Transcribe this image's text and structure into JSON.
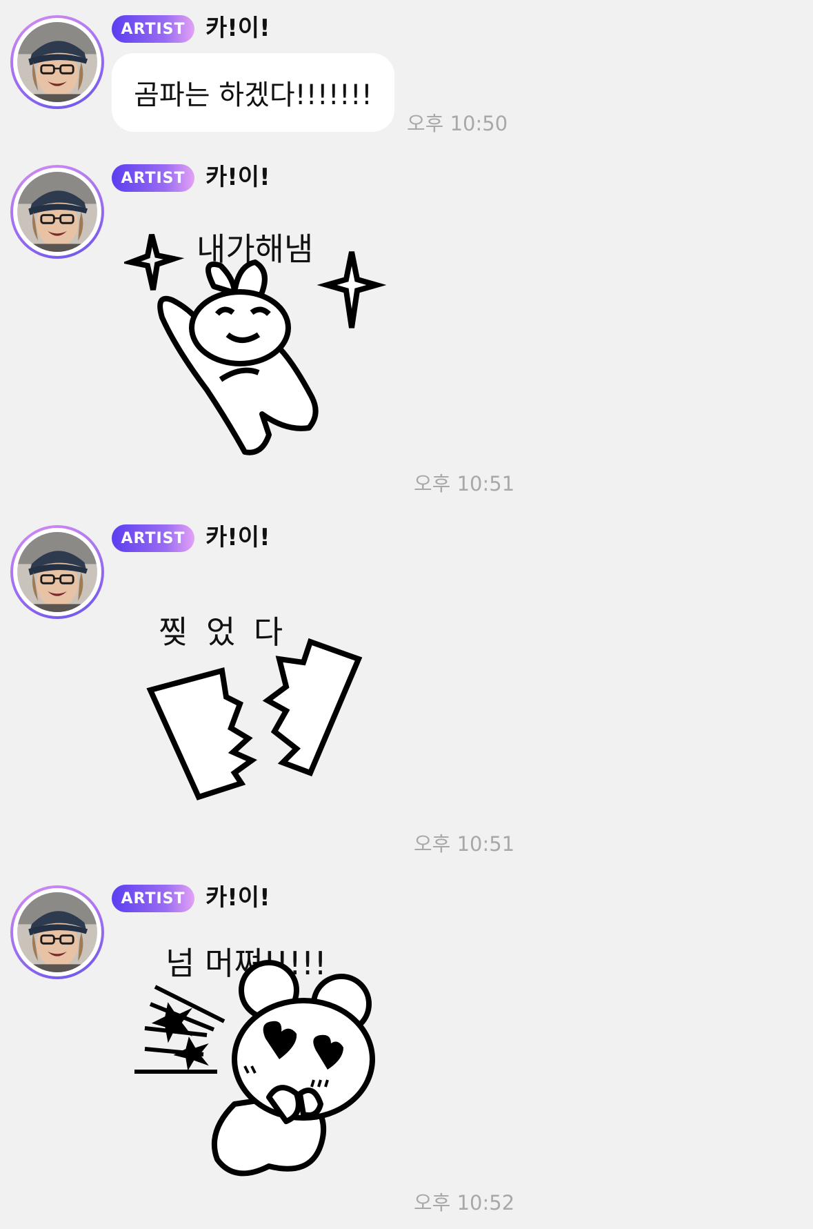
{
  "messages": [
    {
      "badge": "ARTIST",
      "sender": "카!이!",
      "type": "text",
      "text": "곰파는 하겠다!!!!!!!",
      "time": "오후 10:50"
    },
    {
      "badge": "ARTIST",
      "sender": "카!이!",
      "type": "sticker",
      "sticker_text": "내가해냄",
      "sticker_icon": "bunny-sparkles-sticker",
      "time": "오후 10:51"
    },
    {
      "badge": "ARTIST",
      "sender": "카!이!",
      "type": "sticker",
      "sticker_text": "찢 었 다",
      "sticker_icon": "torn-paper-sticker",
      "time": "오후 10:51"
    },
    {
      "badge": "ARTIST",
      "sender": "카!이!",
      "type": "sticker",
      "sticker_text": "넘 머쪄!!!!!",
      "sticker_icon": "bear-heart-eyes-sticker",
      "time": "오후 10:52"
    }
  ],
  "colors": {
    "background": "#f1f1f1",
    "bubble": "#ffffff",
    "badge_start": "#5b3ef0",
    "badge_end": "#e2a2f4",
    "avatar_ring": "#9b6ef0",
    "time": "#a8a8a8"
  }
}
